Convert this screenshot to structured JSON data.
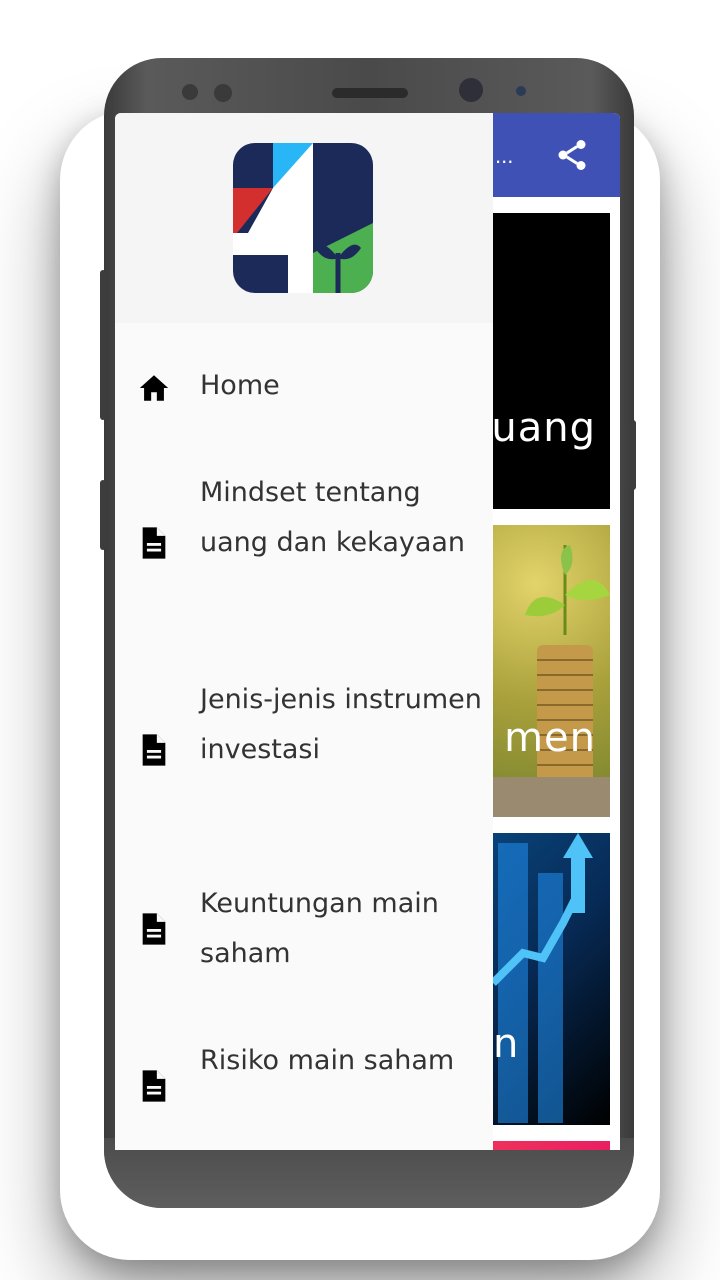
{
  "app": {
    "appbar_title": "...",
    "card_titles": [
      "uang",
      "men",
      "n"
    ]
  },
  "drawer": {
    "items": [
      {
        "label": "Home",
        "icon": "home-icon"
      },
      {
        "label": "Mindset tentang uang dan kekayaan",
        "icon": "document-icon"
      },
      {
        "label": "Jenis-jenis instrumen investasi",
        "icon": "document-icon"
      },
      {
        "label": "Keuntungan main saham",
        "icon": "document-icon"
      },
      {
        "label": "Risiko main saham",
        "icon": "document-icon"
      }
    ]
  },
  "colors": {
    "appbar": "#3f51b5",
    "drawer_bg": "#fafafa",
    "text": "#333333"
  }
}
